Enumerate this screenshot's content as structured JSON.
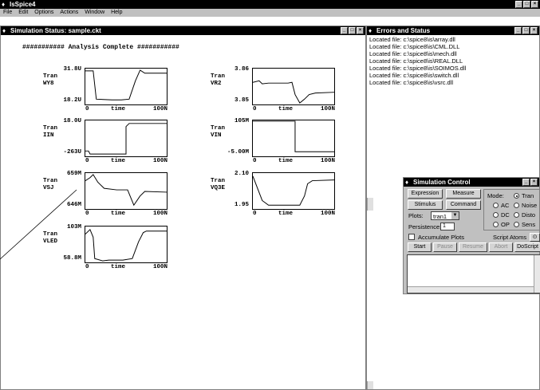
{
  "app": {
    "title": "IsSpice4",
    "menu": [
      "File",
      "Edit",
      "Options",
      "Actions",
      "Window",
      "Help"
    ]
  },
  "sim_window": {
    "title": "Simulation Status: sample.ckt",
    "status": "########### Analysis Complete ###########",
    "xlabel": "time",
    "x_start": "0",
    "x_end": "100N",
    "plots": [
      {
        "type": "Tran",
        "name": "WY8",
        "top": "31.8U",
        "bottom": "18.2U"
      },
      {
        "type": "Tran",
        "name": "VR2",
        "top": "3.86",
        "bottom": "3.85"
      },
      {
        "type": "Tran",
        "name": "IIN",
        "top": "18.0U",
        "bottom": "-263U"
      },
      {
        "type": "Tran",
        "name": "VIN",
        "top": "105M",
        "bottom": "-5.00M"
      },
      {
        "type": "Tran",
        "name": "VSJ",
        "top": "659M",
        "bottom": "646M"
      },
      {
        "type": "Tran",
        "name": "VQ3E",
        "top": "2.10",
        "bottom": "1.95"
      },
      {
        "type": "Tran",
        "name": "VLED",
        "top": "103M",
        "bottom": "58.8M"
      }
    ]
  },
  "errors_window": {
    "title": "Errors and Status",
    "lines": [
      "Located file: c:\\spice8\\is\\array.dll",
      "Located file: c:\\spice8\\is\\CML.DLL",
      "Located file: c:\\spice8\\is\\mech.dll",
      "Located file: c:\\spice8\\is\\REAL.DLL",
      "Located file: c:\\spice8\\is\\SOIMOS.dll",
      "Located file: c:\\spice8\\is\\switch.dll",
      "Located file: c:\\spice8\\is\\vsrc.dll"
    ]
  },
  "sim_control": {
    "title": "Simulation Control",
    "expression": "Expression",
    "measure": "Measure",
    "stimulus": "Stimulus",
    "command": "Command",
    "plots_label": "Plots:",
    "plots_value": "tran1",
    "persistence_label": "Persistence:",
    "persistence_value": "1",
    "accumulate": "Accumulate Plots",
    "mode_label": "Mode:",
    "modes": [
      "Tran",
      "AC",
      "Noise",
      "DC",
      "Disto",
      "OP",
      "Sens"
    ],
    "script_atoms": "Script Atoms",
    "start": "Start",
    "pause": "Pause",
    "resume": "Resume",
    "abort": "Abort",
    "doscript": "DoScript"
  }
}
